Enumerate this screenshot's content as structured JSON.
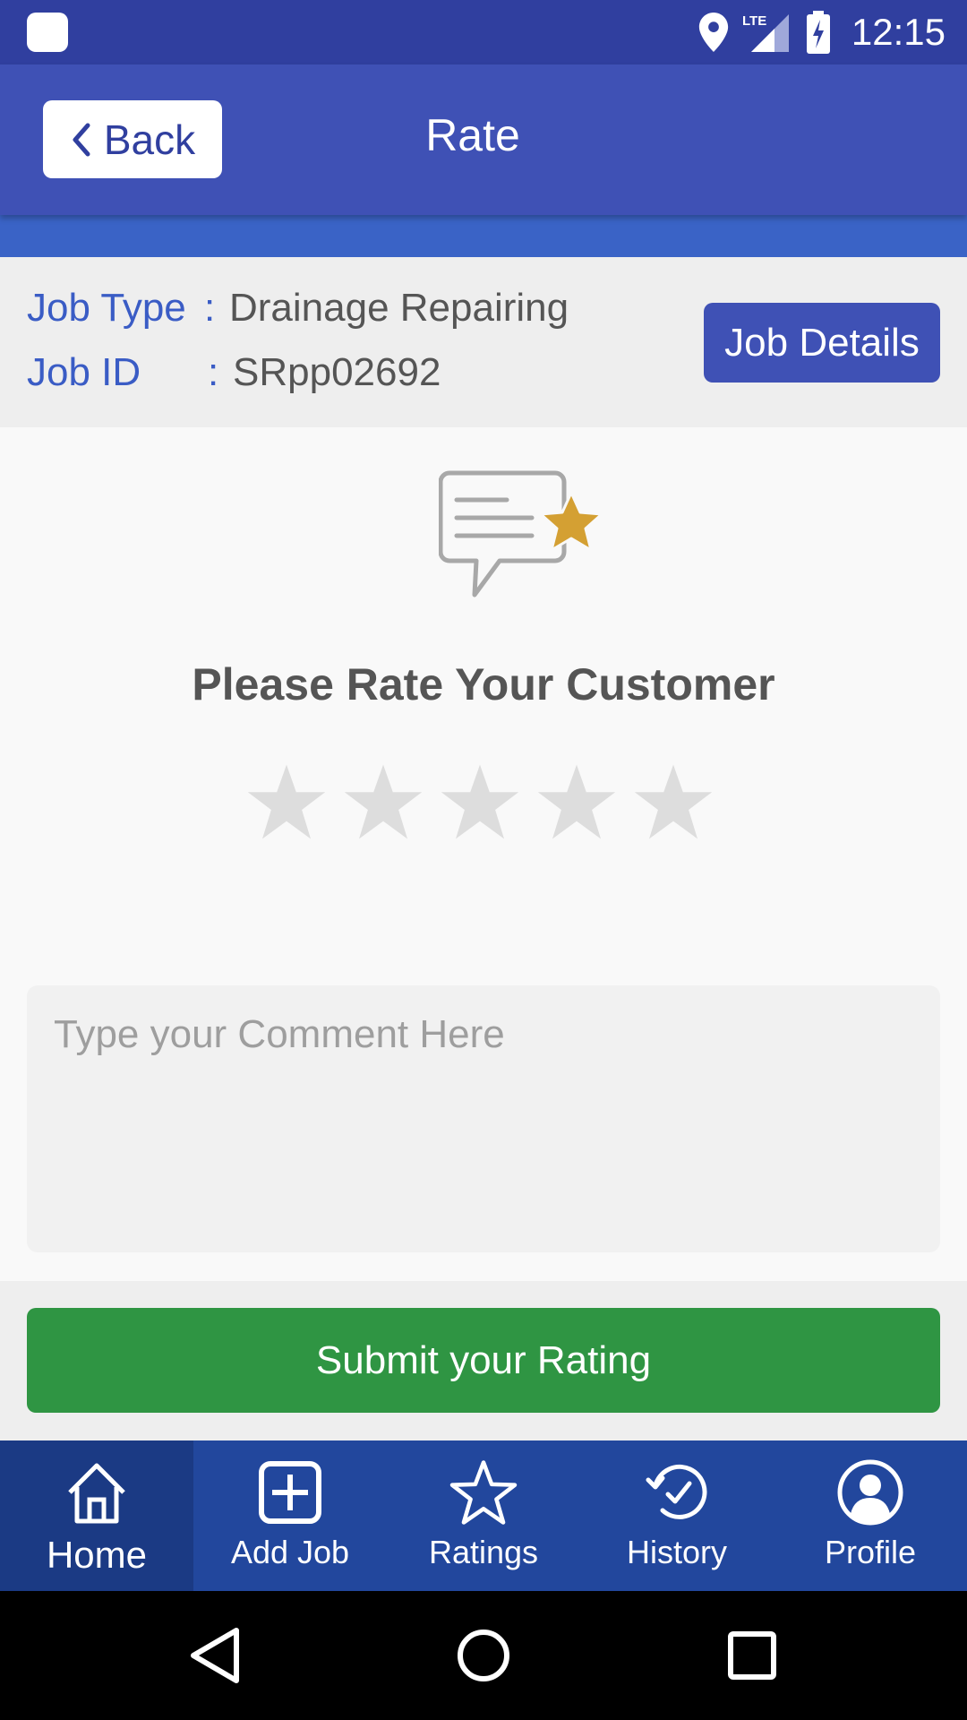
{
  "status_bar": {
    "time": "12:15",
    "network": "LTE"
  },
  "app_bar": {
    "back_label": "Back",
    "title": "Rate"
  },
  "job": {
    "type_label": "Job Type",
    "type_value": "Drainage Repairing",
    "id_label": "Job ID",
    "id_value": "SRpp02692",
    "separator": ":",
    "details_button": "Job Details"
  },
  "rating": {
    "heading": "Please Rate Your Customer",
    "max_stars": 5,
    "selected_stars": 0,
    "comment_placeholder": "Type your Comment Here",
    "submit_label": "Submit your Rating"
  },
  "bottom_nav": [
    {
      "label": "Home",
      "icon": "home-icon",
      "active": true
    },
    {
      "label": "Add Job",
      "icon": "add-box-icon",
      "active": false
    },
    {
      "label": "Ratings",
      "icon": "star-outline-icon",
      "active": false
    },
    {
      "label": "History",
      "icon": "history-icon",
      "active": false
    },
    {
      "label": "Profile",
      "icon": "profile-icon",
      "active": false
    }
  ],
  "colors": {
    "primary": "#3f51b5",
    "status_bar": "#303f9f",
    "accent_blue": "#3a5cc5",
    "submit_green": "#2f9543",
    "nav_bg": "#22479d",
    "star_empty": "#dddddd",
    "star_gold": "#d4a033"
  }
}
